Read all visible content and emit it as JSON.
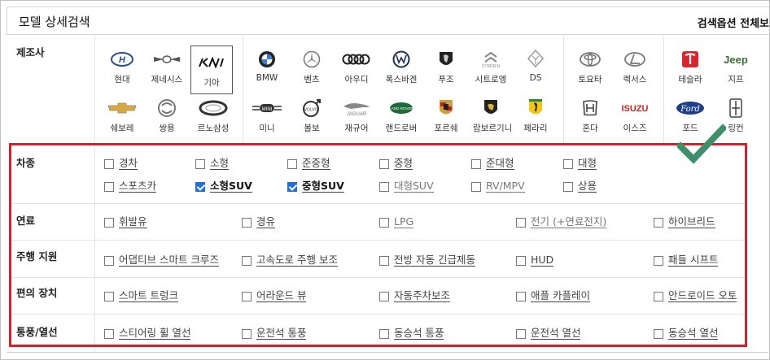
{
  "header": {
    "title": "모델 상세검색",
    "search_options_toggle": "검색옵션 전체보"
  },
  "rows": {
    "maker_label": "제조사",
    "vehicle_type_label": "차종",
    "fuel_label": "연료",
    "driving_assist_label": "주행 지원",
    "convenience_label": "편의 장치",
    "ventilation_label": "통풍/열선"
  },
  "makers": [
    {
      "name": "현대",
      "icon": "hyundai-logo"
    },
    {
      "name": "제네시스",
      "icon": "genesis-logo"
    },
    {
      "name": "기아",
      "icon": "kia-logo",
      "selected": true
    },
    {
      "name": "쉐보레",
      "icon": "chevrolet-logo"
    },
    {
      "name": "쌍용",
      "icon": "ssangyong-logo"
    },
    {
      "name": "르노삼성",
      "icon": "renault-samsung-logo"
    },
    {
      "name": "BMW",
      "icon": "bmw-logo"
    },
    {
      "name": "벤츠",
      "icon": "mercedes-logo"
    },
    {
      "name": "아우디",
      "icon": "audi-logo"
    },
    {
      "name": "폭스바겐",
      "icon": "volkswagen-logo"
    },
    {
      "name": "푸조",
      "icon": "peugeot-logo"
    },
    {
      "name": "시트로엥",
      "icon": "citroen-logo"
    },
    {
      "name": "DS",
      "icon": "ds-logo"
    },
    {
      "name": "미니",
      "icon": "mini-logo"
    },
    {
      "name": "볼보",
      "icon": "volvo-logo"
    },
    {
      "name": "재규어",
      "icon": "jaguar-logo"
    },
    {
      "name": "랜드로버",
      "icon": "landrover-logo"
    },
    {
      "name": "포르쉐",
      "icon": "porsche-logo"
    },
    {
      "name": "람보르기니",
      "icon": "lamborghini-logo"
    },
    {
      "name": "페라리",
      "icon": "ferrari-logo"
    },
    {
      "name": "토요타",
      "icon": "toyota-logo"
    },
    {
      "name": "렉서스",
      "icon": "lexus-logo"
    },
    {
      "name": "혼다",
      "icon": "honda-logo"
    },
    {
      "name": "이스즈",
      "icon": "isuzu-logo"
    },
    {
      "name": "테슬라",
      "icon": "tesla-logo"
    },
    {
      "name": "지프",
      "icon": "jeep-logo"
    },
    {
      "name": "포드",
      "icon": "ford-logo"
    },
    {
      "name": "링컨",
      "icon": "lincoln-logo"
    }
  ],
  "logo_text": {
    "jeep": "Jeep",
    "isuzu": "ISUZU",
    "ford": "Ford",
    "mini": "MINI",
    "volvo": "VOLVO",
    "jaguar": "JAGUAR",
    "landrover": "LAND ROVER"
  },
  "vehicle_types": [
    {
      "label": "경차",
      "checked": false
    },
    {
      "label": "소형",
      "checked": false
    },
    {
      "label": "준중형",
      "checked": false
    },
    {
      "label": "중형",
      "checked": false
    },
    {
      "label": "준대형",
      "checked": false
    },
    {
      "label": "대형",
      "checked": false
    },
    {
      "label": "스포츠카",
      "checked": false
    },
    {
      "label": "소형SUV",
      "checked": true
    },
    {
      "label": "중형SUV",
      "checked": true
    },
    {
      "label": "대형SUV",
      "checked": false
    },
    {
      "label": "RV/MPV",
      "checked": false
    },
    {
      "label": "상용",
      "checked": false
    }
  ],
  "fuel": [
    {
      "label": "휘발유",
      "checked": false
    },
    {
      "label": "경유",
      "checked": false
    },
    {
      "label": "LPG",
      "checked": false
    },
    {
      "label": "전기 (+연료전지)",
      "checked": false
    },
    {
      "label": "하이브리드",
      "checked": false
    }
  ],
  "driving_assist": [
    {
      "label": "어댑티브 스마트 크루즈",
      "checked": false
    },
    {
      "label": "고속도로 주행 보조",
      "checked": false
    },
    {
      "label": "전방 자동 긴급제동",
      "checked": false
    },
    {
      "label": "HUD",
      "checked": false
    },
    {
      "label": "패들 시프트",
      "checked": false
    }
  ],
  "convenience": [
    {
      "label": "스마트 트렁크",
      "checked": false
    },
    {
      "label": "어라운드 뷰",
      "checked": false
    },
    {
      "label": "자동주차보조",
      "checked": false
    },
    {
      "label": "애플 카플레이",
      "checked": false
    },
    {
      "label": "안드로이드 오토",
      "checked": false
    }
  ],
  "ventilation": [
    {
      "label": "스티어링 휠 열선",
      "checked": false
    },
    {
      "label": "운전석 통풍",
      "checked": false
    },
    {
      "label": "동승석 통풍",
      "checked": false
    },
    {
      "label": "운전석 열선",
      "checked": false
    },
    {
      "label": "동승석 열선",
      "checked": false
    }
  ],
  "colors": {
    "highlight_box": "#d4202b",
    "check_accent": "#1f6fd6",
    "annotation_check": "#3f8f6a"
  }
}
